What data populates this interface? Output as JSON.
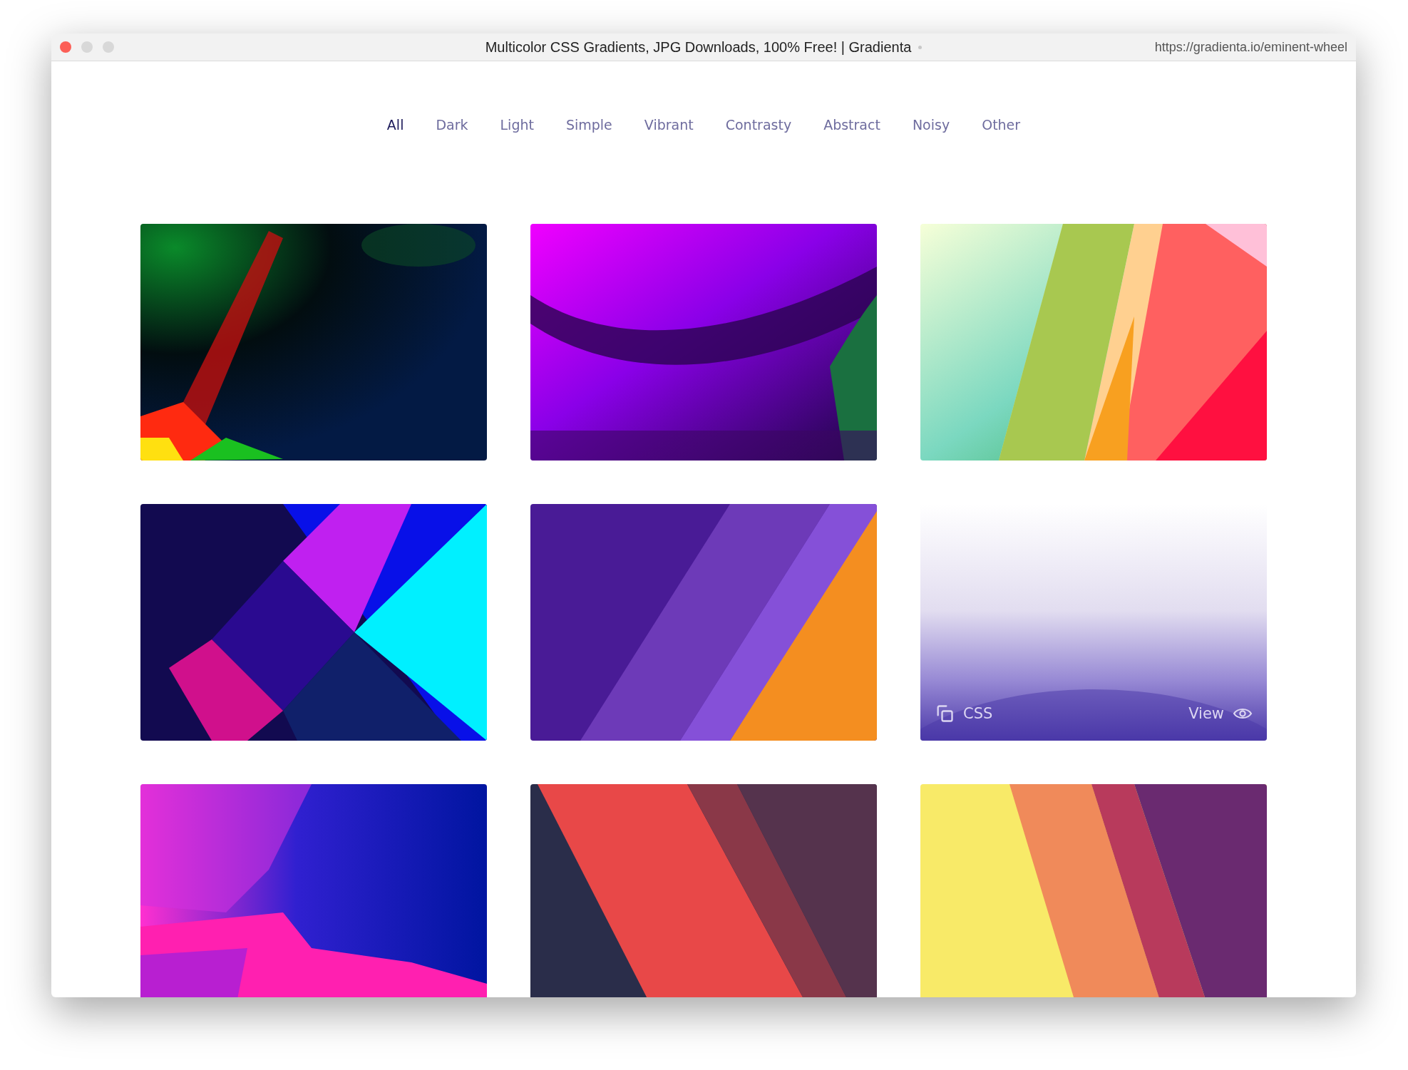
{
  "window": {
    "title": "Multicolor CSS Gradients, JPG Downloads, 100% Free! | Gradienta",
    "url": "https://gradienta.io/eminent-wheel"
  },
  "tabs": [
    {
      "label": "All",
      "selected": true
    },
    {
      "label": "Dark",
      "selected": false
    },
    {
      "label": "Light",
      "selected": false
    },
    {
      "label": "Simple",
      "selected": false
    },
    {
      "label": "Vibrant",
      "selected": false
    },
    {
      "label": "Contrasty",
      "selected": false
    },
    {
      "label": "Abstract",
      "selected": false
    },
    {
      "label": "Noisy",
      "selected": false
    },
    {
      "label": "Other",
      "selected": false
    }
  ],
  "cards": [
    {
      "kind": "picture"
    },
    {
      "kind": "picture"
    },
    {
      "kind": "picture"
    },
    {
      "kind": "picture"
    },
    {
      "kind": "picture"
    },
    {
      "kind": "picture",
      "actions": {
        "copy": "CSS",
        "view": "View"
      }
    },
    {
      "kind": "picture"
    },
    {
      "kind": "picture"
    },
    {
      "kind": "picture"
    }
  ]
}
